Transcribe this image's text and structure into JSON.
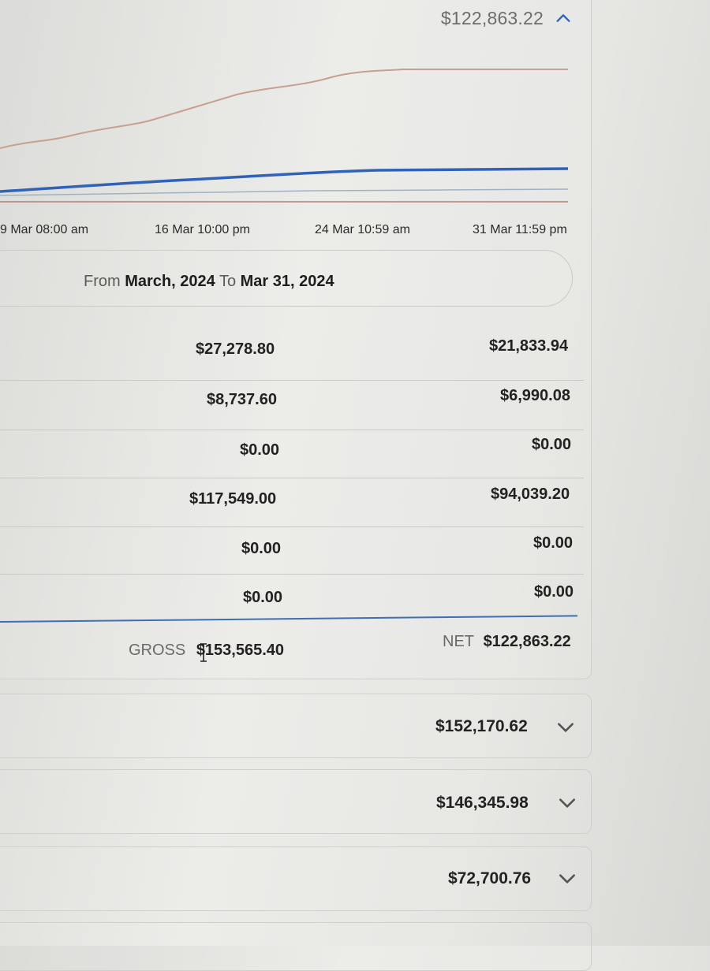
{
  "summary": {
    "total": "$122,863.22",
    "expand_icon": "chevron-up-icon"
  },
  "chart": {
    "x_ticks": [
      "9 Mar 08:00 am",
      "16 Mar 10:00 pm",
      "24 Mar 10:59 am",
      "31 Mar 11:59 pm"
    ],
    "colors": {
      "gross_line": "#c8a08f",
      "net_line": "#2f62b8",
      "light_line": "#9db3c4",
      "baseline": "#b57c7c"
    }
  },
  "date_range": {
    "from_label": "From",
    "from_value": "March, 2024",
    "to_label": "To",
    "to_value": "Mar 31, 2024"
  },
  "table": {
    "rows": [
      {
        "gross": "$27,278.80",
        "net": "$21,833.94"
      },
      {
        "gross": "$8,737.60",
        "net": "$6,990.08"
      },
      {
        "gross": "$0.00",
        "net": "$0.00"
      },
      {
        "gross": "$117,549.00",
        "net": "$94,039.20"
      },
      {
        "gross": "$0.00",
        "net": "$0.00"
      },
      {
        "gross": "$0.00",
        "net": "$0.00"
      }
    ],
    "gross_label": "GROSS",
    "gross_total": "$153,565.40",
    "net_label": "NET",
    "net_total": "$122,863.22"
  },
  "other_periods": [
    {
      "total": "$152,170.62",
      "icon": "chevron-down-icon"
    },
    {
      "total": "$146,345.98",
      "icon": "chevron-down-icon"
    },
    {
      "total": "$72,700.76",
      "icon": "chevron-down-icon"
    }
  ]
}
